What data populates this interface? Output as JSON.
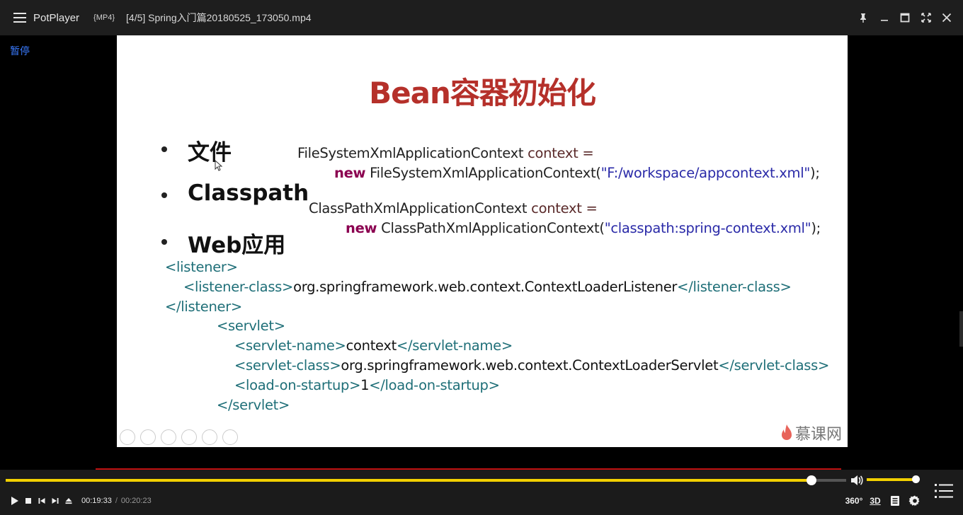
{
  "titlebar": {
    "app_name": "PotPlayer",
    "format": "{MP4}",
    "file_title": "[4/5] Spring入门篇20180525_173050.mp4"
  },
  "osd": {
    "status": "暂停"
  },
  "slide": {
    "title": "Bean容器初始化",
    "bullets": [
      "文件",
      "Classpath",
      "Web应用"
    ],
    "code": {
      "fs_line1_type": "FileSystemXmlApplicationContext",
      "fs_line1_var": " context =",
      "fs_line2_new": "new",
      "fs_line2_ctor": " FileSystemXmlApplicationContext(",
      "fs_line2_str": "\"F:/workspace/appcontext.xml\"",
      "fs_line2_end": ");",
      "cp_line1_type": "ClassPathXmlApplicationContext",
      "cp_line1_var": " context =",
      "cp_line2_new": "new",
      "cp_line2_ctor": " ClassPathXmlApplicationContext(",
      "cp_line2_str": "\"classpath:spring-context.xml\"",
      "cp_line2_end": ");"
    },
    "xml": {
      "listener_open": "<listener>",
      "listener_class_open": "<listener-class>",
      "listener_class_value": "org.springframework.web.context.ContextLoaderListener",
      "listener_class_close": "</listener-class>",
      "listener_close": "</listener>",
      "servlet_open": "<servlet>",
      "servlet_name_open": "<servlet-name>",
      "servlet_name_value": "context",
      "servlet_name_close": "</servlet-name>",
      "servlet_class_open": "<servlet-class>",
      "servlet_class_value": "org.springframework.web.context.ContextLoaderServlet",
      "servlet_class_close": "</servlet-class>",
      "load_open": "<load-on-startup>",
      "load_value": "1",
      "load_close": "</load-on-startup>",
      "servlet_close": "</servlet>"
    },
    "logo_text": "慕课网"
  },
  "player": {
    "current_time": "00:19:33",
    "time_separator": "/",
    "total_time": "00:20:23",
    "progress_fraction": 0.959,
    "volume_fraction": 1.0,
    "btn_360": "360°",
    "btn_3d": "3D"
  },
  "colors": {
    "accent_yellow": "#f2d000",
    "title_red": "#b5302a",
    "osd_blue": "#3a7bff"
  }
}
